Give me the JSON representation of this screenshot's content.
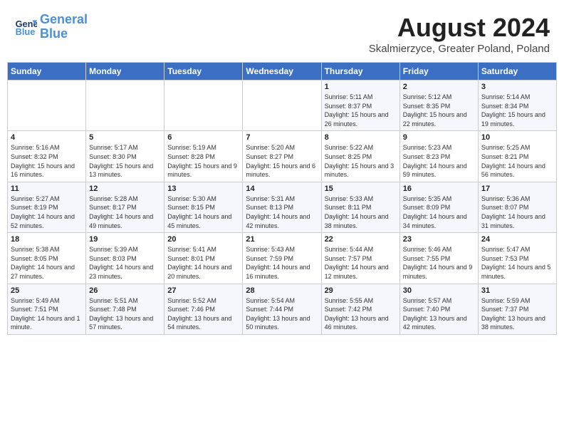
{
  "header": {
    "logo_line1": "General",
    "logo_line2": "Blue",
    "month_title": "August 2024",
    "location": "Skalmierzyce, Greater Poland, Poland"
  },
  "weekdays": [
    "Sunday",
    "Monday",
    "Tuesday",
    "Wednesday",
    "Thursday",
    "Friday",
    "Saturday"
  ],
  "weeks": [
    [
      {
        "day": "",
        "sunrise": "",
        "sunset": "",
        "daylight": ""
      },
      {
        "day": "",
        "sunrise": "",
        "sunset": "",
        "daylight": ""
      },
      {
        "day": "",
        "sunrise": "",
        "sunset": "",
        "daylight": ""
      },
      {
        "day": "",
        "sunrise": "",
        "sunset": "",
        "daylight": ""
      },
      {
        "day": "1",
        "sunrise": "Sunrise: 5:11 AM",
        "sunset": "Sunset: 8:37 PM",
        "daylight": "Daylight: 15 hours and 26 minutes."
      },
      {
        "day": "2",
        "sunrise": "Sunrise: 5:12 AM",
        "sunset": "Sunset: 8:35 PM",
        "daylight": "Daylight: 15 hours and 22 minutes."
      },
      {
        "day": "3",
        "sunrise": "Sunrise: 5:14 AM",
        "sunset": "Sunset: 8:34 PM",
        "daylight": "Daylight: 15 hours and 19 minutes."
      }
    ],
    [
      {
        "day": "4",
        "sunrise": "Sunrise: 5:16 AM",
        "sunset": "Sunset: 8:32 PM",
        "daylight": "Daylight: 15 hours and 16 minutes."
      },
      {
        "day": "5",
        "sunrise": "Sunrise: 5:17 AM",
        "sunset": "Sunset: 8:30 PM",
        "daylight": "Daylight: 15 hours and 13 minutes."
      },
      {
        "day": "6",
        "sunrise": "Sunrise: 5:19 AM",
        "sunset": "Sunset: 8:28 PM",
        "daylight": "Daylight: 15 hours and 9 minutes."
      },
      {
        "day": "7",
        "sunrise": "Sunrise: 5:20 AM",
        "sunset": "Sunset: 8:27 PM",
        "daylight": "Daylight: 15 hours and 6 minutes."
      },
      {
        "day": "8",
        "sunrise": "Sunrise: 5:22 AM",
        "sunset": "Sunset: 8:25 PM",
        "daylight": "Daylight: 15 hours and 3 minutes."
      },
      {
        "day": "9",
        "sunrise": "Sunrise: 5:23 AM",
        "sunset": "Sunset: 8:23 PM",
        "daylight": "Daylight: 14 hours and 59 minutes."
      },
      {
        "day": "10",
        "sunrise": "Sunrise: 5:25 AM",
        "sunset": "Sunset: 8:21 PM",
        "daylight": "Daylight: 14 hours and 56 minutes."
      }
    ],
    [
      {
        "day": "11",
        "sunrise": "Sunrise: 5:27 AM",
        "sunset": "Sunset: 8:19 PM",
        "daylight": "Daylight: 14 hours and 52 minutes."
      },
      {
        "day": "12",
        "sunrise": "Sunrise: 5:28 AM",
        "sunset": "Sunset: 8:17 PM",
        "daylight": "Daylight: 14 hours and 49 minutes."
      },
      {
        "day": "13",
        "sunrise": "Sunrise: 5:30 AM",
        "sunset": "Sunset: 8:15 PM",
        "daylight": "Daylight: 14 hours and 45 minutes."
      },
      {
        "day": "14",
        "sunrise": "Sunrise: 5:31 AM",
        "sunset": "Sunset: 8:13 PM",
        "daylight": "Daylight: 14 hours and 42 minutes."
      },
      {
        "day": "15",
        "sunrise": "Sunrise: 5:33 AM",
        "sunset": "Sunset: 8:11 PM",
        "daylight": "Daylight: 14 hours and 38 minutes."
      },
      {
        "day": "16",
        "sunrise": "Sunrise: 5:35 AM",
        "sunset": "Sunset: 8:09 PM",
        "daylight": "Daylight: 14 hours and 34 minutes."
      },
      {
        "day": "17",
        "sunrise": "Sunrise: 5:36 AM",
        "sunset": "Sunset: 8:07 PM",
        "daylight": "Daylight: 14 hours and 31 minutes."
      }
    ],
    [
      {
        "day": "18",
        "sunrise": "Sunrise: 5:38 AM",
        "sunset": "Sunset: 8:05 PM",
        "daylight": "Daylight: 14 hours and 27 minutes."
      },
      {
        "day": "19",
        "sunrise": "Sunrise: 5:39 AM",
        "sunset": "Sunset: 8:03 PM",
        "daylight": "Daylight: 14 hours and 23 minutes."
      },
      {
        "day": "20",
        "sunrise": "Sunrise: 5:41 AM",
        "sunset": "Sunset: 8:01 PM",
        "daylight": "Daylight: 14 hours and 20 minutes."
      },
      {
        "day": "21",
        "sunrise": "Sunrise: 5:43 AM",
        "sunset": "Sunset: 7:59 PM",
        "daylight": "Daylight: 14 hours and 16 minutes."
      },
      {
        "day": "22",
        "sunrise": "Sunrise: 5:44 AM",
        "sunset": "Sunset: 7:57 PM",
        "daylight": "Daylight: 14 hours and 12 minutes."
      },
      {
        "day": "23",
        "sunrise": "Sunrise: 5:46 AM",
        "sunset": "Sunset: 7:55 PM",
        "daylight": "Daylight: 14 hours and 9 minutes."
      },
      {
        "day": "24",
        "sunrise": "Sunrise: 5:47 AM",
        "sunset": "Sunset: 7:53 PM",
        "daylight": "Daylight: 14 hours and 5 minutes."
      }
    ],
    [
      {
        "day": "25",
        "sunrise": "Sunrise: 5:49 AM",
        "sunset": "Sunset: 7:51 PM",
        "daylight": "Daylight: 14 hours and 1 minute."
      },
      {
        "day": "26",
        "sunrise": "Sunrise: 5:51 AM",
        "sunset": "Sunset: 7:48 PM",
        "daylight": "Daylight: 13 hours and 57 minutes."
      },
      {
        "day": "27",
        "sunrise": "Sunrise: 5:52 AM",
        "sunset": "Sunset: 7:46 PM",
        "daylight": "Daylight: 13 hours and 54 minutes."
      },
      {
        "day": "28",
        "sunrise": "Sunrise: 5:54 AM",
        "sunset": "Sunset: 7:44 PM",
        "daylight": "Daylight: 13 hours and 50 minutes."
      },
      {
        "day": "29",
        "sunrise": "Sunrise: 5:55 AM",
        "sunset": "Sunset: 7:42 PM",
        "daylight": "Daylight: 13 hours and 46 minutes."
      },
      {
        "day": "30",
        "sunrise": "Sunrise: 5:57 AM",
        "sunset": "Sunset: 7:40 PM",
        "daylight": "Daylight: 13 hours and 42 minutes."
      },
      {
        "day": "31",
        "sunrise": "Sunrise: 5:59 AM",
        "sunset": "Sunset: 7:37 PM",
        "daylight": "Daylight: 13 hours and 38 minutes."
      }
    ]
  ]
}
